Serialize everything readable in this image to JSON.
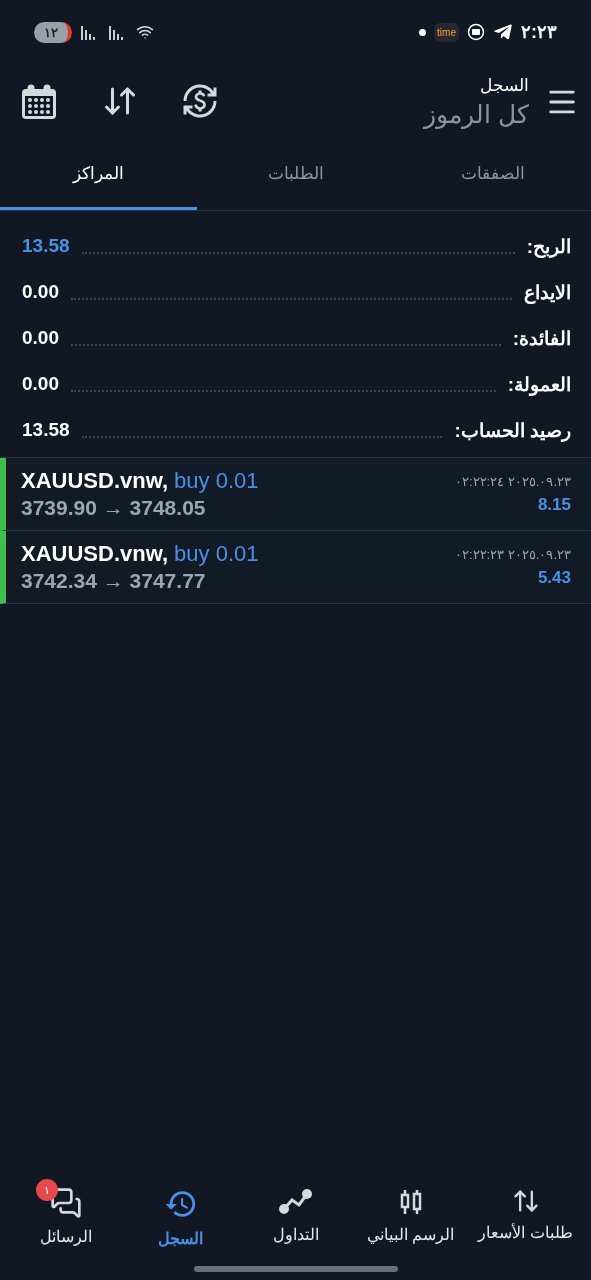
{
  "status_bar": {
    "time": "٢:٢٣",
    "app_badge": "time",
    "battery": "١٢"
  },
  "header": {
    "title": "السجل",
    "subtitle": "كل الرموز"
  },
  "tabs": [
    {
      "label": "الصفقات",
      "selected": false
    },
    {
      "label": "الطلبات",
      "selected": false
    },
    {
      "label": "المراكز",
      "selected": true
    }
  ],
  "summary": [
    {
      "label": "الربح:",
      "value": "13.58",
      "highlight": true
    },
    {
      "label": "الايداع",
      "value": "0.00",
      "highlight": false
    },
    {
      "label": "الفائدة:",
      "value": "0.00",
      "highlight": false
    },
    {
      "label": "العمولة:",
      "value": "0.00",
      "highlight": false
    },
    {
      "label": "رصيد الحساب:",
      "value": "13.58",
      "highlight": false
    }
  ],
  "trades": [
    {
      "symbol": "XAUUSD.vnw,",
      "side": "buy 0.01",
      "prices": "3739.90 → 3748.05",
      "time": "٢٠٢٥.٠٩.٢٣ ٠٢:٢٢:٢٤",
      "profit": "8.15"
    },
    {
      "symbol": "XAUUSD.vnw,",
      "side": "buy 0.01",
      "prices": "3742.34 → 3747.77",
      "time": "٢٠٢٥.٠٩.٢٣ ٠٢:٢٢:٢٣",
      "profit": "5.43"
    }
  ],
  "bottom_nav": [
    {
      "label": "طلبات الأسعار",
      "kind": "quotes",
      "selected": false
    },
    {
      "label": "الرسم البياني",
      "kind": "chart",
      "selected": false
    },
    {
      "label": "التداول",
      "kind": "trade",
      "selected": false
    },
    {
      "label": "السجل",
      "kind": "history",
      "selected": true
    },
    {
      "label": "الرسائل",
      "kind": "messages",
      "selected": false,
      "badge": "١"
    }
  ]
}
